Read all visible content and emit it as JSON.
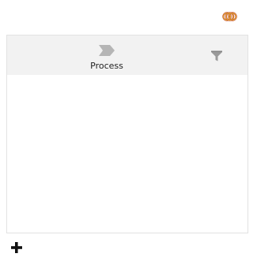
{
  "toolbar": {
    "rings_icon": "linked-rings-icon"
  },
  "panel": {
    "header": {
      "columns": [
        {
          "label": "Process",
          "icon": "process-step-icon"
        }
      ],
      "filter_icon": "filter-icon"
    },
    "rows": []
  },
  "footer": {
    "add_icon": "plus-icon"
  },
  "colors": {
    "header_bg": "#f2f2f2",
    "border": "#e2e2e2",
    "icon_gray": "#b5b5b5",
    "rings_gold": "#d9a32a",
    "rings_red": "#c0392b"
  }
}
